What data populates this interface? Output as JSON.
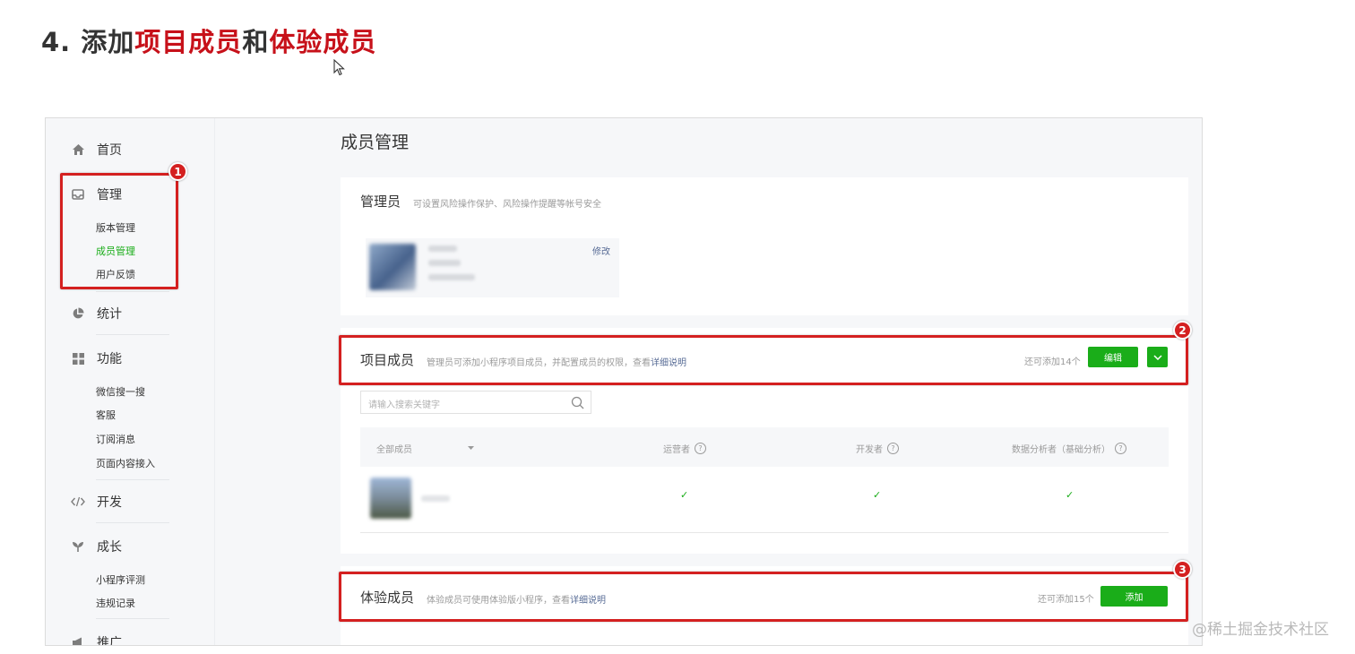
{
  "heading": {
    "prefix": "4. 添加",
    "project_members": "项目成员",
    "and": "和",
    "trial_members": "体验成员"
  },
  "sidebar": {
    "home": "首页",
    "manage": "管理",
    "manage_items": [
      "版本管理",
      "成员管理",
      "用户反馈"
    ],
    "stats": "统计",
    "features": "功能",
    "feature_items": [
      "微信搜一搜",
      "客服",
      "订阅消息",
      "页面内容接入"
    ],
    "develop": "开发",
    "growth": "成长",
    "growth_items": [
      "小程序评测",
      "违规记录"
    ],
    "promote": "推广"
  },
  "main": {
    "title": "成员管理",
    "admin": {
      "title": "管理员",
      "desc": "可设置风险操作保护、风险操作提醒等帐号安全",
      "edit": "修改"
    },
    "project": {
      "title": "项目成员",
      "desc": "管理员可添加小程序项目成员，并配置成员的权限，查看",
      "link": "详细说明",
      "remaining": "还可添加14个",
      "edit_button": "编辑",
      "search_placeholder": "请输入搜索关键字",
      "columns": [
        "全部成员",
        "运营者",
        "开发者",
        "数据分析者（基础分析）"
      ],
      "check": "✓"
    },
    "trial": {
      "title": "体验成员",
      "desc": "体验成员可使用体验版小程序，查看",
      "link": "详细说明",
      "remaining": "还可添加15个",
      "add_button": "添加"
    }
  },
  "badges": [
    "1",
    "2",
    "3"
  ],
  "watermark": "@稀土掘金技术社区",
  "colors": {
    "accent_green": "#1aad19",
    "annotation_red": "#d42020",
    "heading_red": "#c7111a"
  }
}
